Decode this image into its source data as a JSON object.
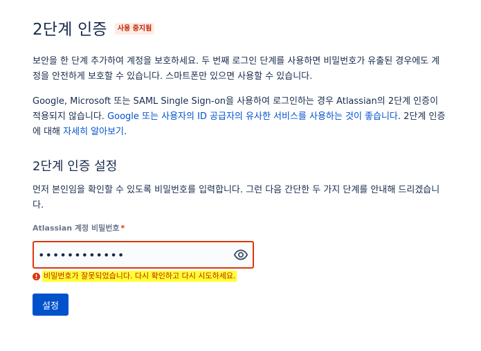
{
  "header": {
    "title": "2단계 인증",
    "status_badge": "사용 중지됨"
  },
  "intro": {
    "paragraph1": "보안을 한 단계 추가하여 계정을 보호하세요. 두 번째 로그인 단계를 사용하면 비밀번호가 유출된 경우에도 계정을 안전하게 보호할 수 있습니다. 스마트폰만 있으면 사용할 수 있습니다.",
    "paragraph2_part1": "Google, Microsoft 또는 SAML Single Sign-on을 사용하여 로그인하는 경우 Atlassian의 2단계 인증이 적용되지 않습니다. ",
    "paragraph2_link1": "Google 또는 사용자의 ID 공급자의 유사한 서비스를 사용하는 것이 좋습니다",
    "paragraph2_part2": ". 2단계 인증에 대해 ",
    "paragraph2_link2": "자세히 알아보기",
    "paragraph2_part3": "."
  },
  "setup": {
    "section_title": "2단계 인증 설정",
    "description": "먼저 본인임을 확인할 수 있도록 비밀번호를 입력합니다. 그런 다음 간단한 두 가지 단계를 안내해 드리겠습니다.",
    "password_label": "Atlassian 계정 비밀번호",
    "required_marker": "*",
    "password_value": "••••••••••••",
    "error_message": "비밀번호가 잘못되었습니다. 다시 확인하고 다시 시도하세요.",
    "submit_label": "설정"
  },
  "colors": {
    "text": "#172B4D",
    "link": "#0052CC",
    "error": "#DE350B",
    "badge_bg": "#FFEBE6",
    "badge_text": "#BF2600",
    "button_bg": "#0052CC",
    "highlight": "#FFFF33"
  },
  "icons": {
    "password_toggle": "eye-icon",
    "error": "error-icon"
  }
}
